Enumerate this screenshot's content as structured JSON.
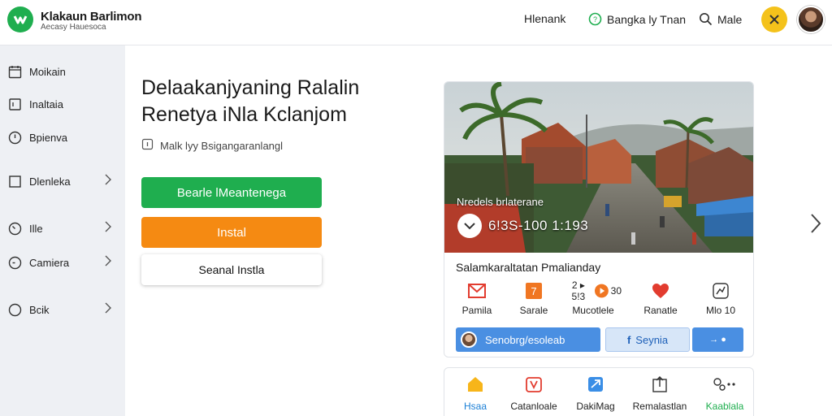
{
  "header": {
    "brand_title": "Klakaun Barlimon",
    "brand_sub": "Aecasy Hauesoca",
    "nav": [
      {
        "label": "Hlenank",
        "icon": ""
      },
      {
        "label": "Bangka ly Tnan",
        "icon": "help-circle-icon"
      },
      {
        "label": "Male",
        "icon": "search-icon"
      }
    ]
  },
  "sidebar": {
    "items": [
      {
        "label": "Moikain",
        "icon": "calendar-icon"
      },
      {
        "label": "Inaltaia",
        "icon": "document-icon"
      },
      {
        "label": "Bpienva",
        "icon": "clock-icon"
      },
      {
        "label": "Dlenleka",
        "icon": "square-icon",
        "chevron": true
      },
      {
        "label": "Ille",
        "icon": "timer-icon",
        "chevron": true
      },
      {
        "label": "Camiera",
        "icon": "compass-icon",
        "chevron": true
      },
      {
        "label": "Bcik",
        "icon": "circle-icon",
        "chevron": true
      }
    ]
  },
  "main": {
    "title_line1": "Delaakanjyaning Ralalin",
    "title_line2": "Renetya iNla Kclanjom",
    "note": "Malk lyy Bsigangaranlangl",
    "buttons": {
      "primary": "Bearle lMeantenega",
      "secondary": "Instal",
      "tertiary": "Seanal Instla"
    }
  },
  "card": {
    "photo_label": "Nredels brlaterane",
    "photo_stat": "6!3S-100 1:193",
    "title": "Salamkaraltatan Pmalianday",
    "icons": [
      {
        "label": "Pamila",
        "icon": "mail-icon"
      },
      {
        "label": "Sarale",
        "icon": "calendar-icon",
        "badge": "7"
      },
      {
        "label": "Mucotlele",
        "icon": "video-icon",
        "prefix": "2 ▸ 5!3",
        "suffix": "30"
      },
      {
        "label": "Ranatle",
        "icon": "heart-icon"
      },
      {
        "label": "Mlo 10",
        "icon": "activity-icon"
      }
    ],
    "pills": {
      "left": "Senobrg/esoleab",
      "mid": "Seynia",
      "right": "→ ●"
    }
  },
  "bottom_nav": [
    {
      "label": "Hsaa",
      "icon": "home-icon",
      "active": true
    },
    {
      "label": "Catanloale",
      "icon": "gift-icon"
    },
    {
      "label": "DakiMag",
      "icon": "send-icon"
    },
    {
      "label": "Remalastlan",
      "icon": "upload-icon"
    },
    {
      "label": "Kaablala",
      "icon": "settings-icon",
      "active": true
    }
  ],
  "colors": {
    "brand_green": "#1fae4f",
    "accent_orange": "#f58a12",
    "accent_blue": "#4a8fe2",
    "close_yellow": "#f4c21b"
  }
}
